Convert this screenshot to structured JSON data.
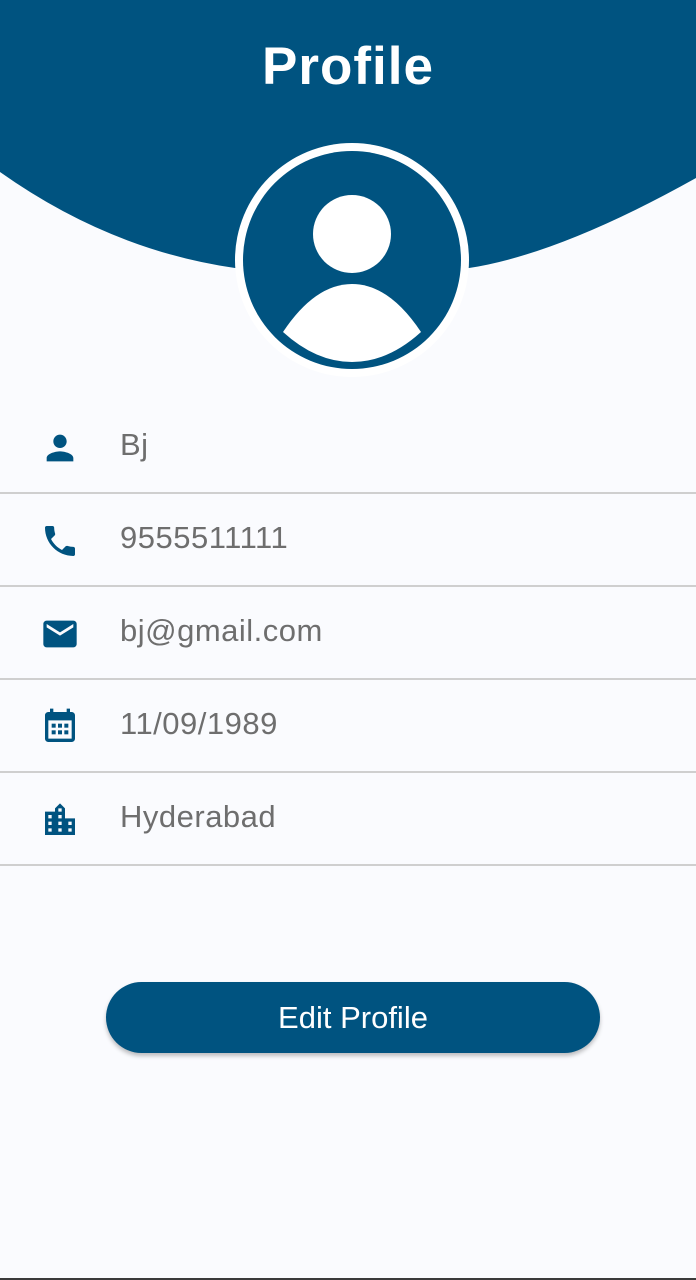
{
  "header": {
    "title": "Profile"
  },
  "colors": {
    "primary": "#005380",
    "background": "#fafbfe",
    "text_secondary": "#6e6e6e",
    "divider": "#cfcfcf"
  },
  "profile": {
    "avatar_icon": "person-avatar-icon",
    "fields": [
      {
        "icon": "person-icon",
        "value": "Bj"
      },
      {
        "icon": "phone-icon",
        "value": "9555511111"
      },
      {
        "icon": "email-icon",
        "value": "bj@gmail.com"
      },
      {
        "icon": "calendar-icon",
        "value": "11/09/1989"
      },
      {
        "icon": "city-icon",
        "value": "Hyderabad"
      }
    ]
  },
  "actions": {
    "edit_label": "Edit Profile"
  }
}
